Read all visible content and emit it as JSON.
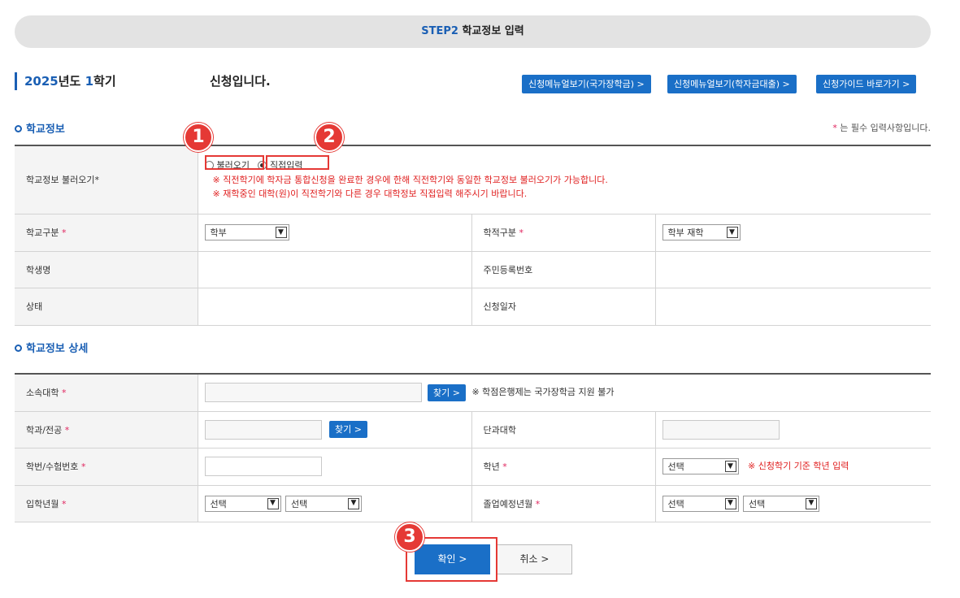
{
  "step": {
    "num": "STEP2",
    "title": "학교정보 입력"
  },
  "semester": {
    "year": "2025",
    "year_suffix": "년도 ",
    "term": "1",
    "term_suffix": "학기"
  },
  "applying_text": "신청입니다.",
  "top_buttons": [
    "신청메뉴얼보기(국가장학금) >",
    "신청메뉴얼보기(학자금대출) >",
    "신청가이드 바로가기 >"
  ],
  "section1": {
    "title": "학교정보",
    "required_note_star": "*",
    "required_note": " 는 필수 입력사항입니다.",
    "load_label": "학교정보 불러오기*",
    "radio_load": "불러오기",
    "radio_direct": "직접입력",
    "warn1": "※ 직전학기에 학자금 통합신청을 완료한 경우에 한해 직전학기와 동일한 학교정보 불러오기가 가능합니다.",
    "warn2": "※ 재학중인 대학(원)이 직전학기와 다른 경우 대학정보 직접입력 해주시기 바랍니다.",
    "school_type_label": "학교구분",
    "school_type_value": "학부",
    "enroll_type_label": "학적구분",
    "enroll_type_value": "학부 재학",
    "student_name_label": "학생명",
    "resident_no_label": "주민등록번호",
    "status_label": "상태",
    "apply_date_label": "신청일자"
  },
  "section2": {
    "title": "학교정보 상세",
    "university_label": "소속대학",
    "find_label": "찾기 >",
    "credit_bank_note": "※ 학점은행제는 국가장학금 지원 불가",
    "dept_label": "학과/전공",
    "college_label": "단과대학",
    "student_no_label": "학번/수험번호",
    "grade_label": "학년",
    "grade_value": "선택",
    "grade_note": "※ 신청학기 기준 학년 입력",
    "entry_label": "입학년월",
    "entry_year": "선택",
    "entry_month": "선택",
    "grad_label": "졸업예정년월",
    "grad_year": "선택",
    "grad_month": "선택"
  },
  "star": "*",
  "confirm_label": "확인   >",
  "cancel_label": "취소   >",
  "badges": [
    "1",
    "2",
    "3"
  ],
  "colors": {
    "accent": "#1a6fc7",
    "annotation": "#e53935",
    "warning": "#e02020"
  }
}
